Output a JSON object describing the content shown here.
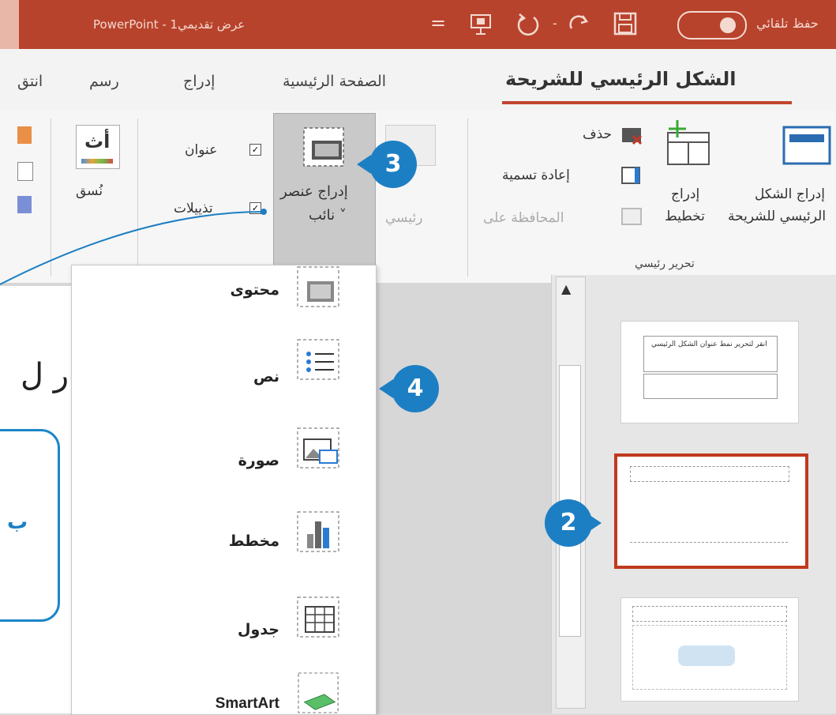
{
  "title_bar": {
    "app_title": "PowerPoint - عرض تقديمي1",
    "autosave": "حفظ تلقائي",
    "ribbon_options": "="
  },
  "tabs": {
    "active": "الشكل الرئيسي للشريحة",
    "home": "الصفحة الرئيسية",
    "insert": "إدراج",
    "draw": "رسم",
    "partial": "انتق"
  },
  "ribbon": {
    "insert_slide_master_line1": "إدراج الشكل",
    "insert_slide_master_line2": "الرئيسي للشريحة",
    "insert_layout_line1": "إدراج",
    "insert_layout_line2": "تخطيط",
    "delete": "حذف",
    "rename": "إعادة تسمية",
    "preserve": "المحافظة على",
    "group_edit_master": "تحرير رئيسي",
    "master_layout": "رئيسي",
    "insert_placeholder_line1": "إدراج عنصر",
    "insert_placeholder_line2": "نائب ˅",
    "title_checkbox": "عنوان",
    "footers_checkbox": "تذييلات",
    "theme_char": "أث",
    "format_label": "نُسق"
  },
  "placeholder_menu": {
    "items": [
      "محتوى",
      "نص",
      "صورة",
      "مخطط",
      "جدول",
      "SmartArt"
    ]
  },
  "callouts": {
    "badge_2": "2",
    "badge_3": "3",
    "badge_4": "4",
    "box_char": "ب"
  },
  "canvas": {
    "partial_text": "ر ل"
  },
  "thumbnails": {
    "thumb1_text": "انقر لتحرير نمط عنوان الشكل الرئيسي"
  },
  "colors": {
    "title_bar": "#b8432c",
    "accent_underline": "#c14530",
    "callout_blue": "#1d7fc3",
    "selected_thumb_border": "#c0391e"
  }
}
